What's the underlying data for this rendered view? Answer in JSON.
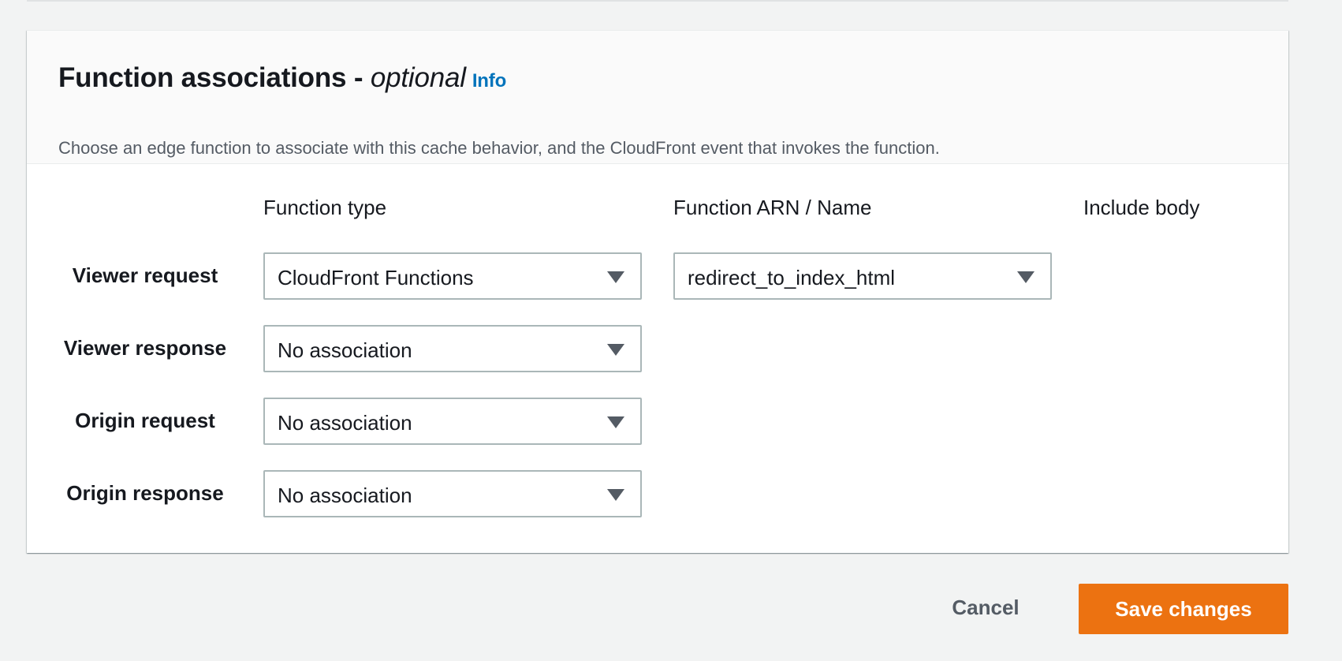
{
  "panel": {
    "title": "Function associations",
    "title_dash": " - ",
    "title_optional": "optional",
    "info_link": "Info",
    "description": "Choose an edge function to associate with this cache behavior, and the CloudFront event that invokes the function."
  },
  "columns": {
    "function_type": "Function type",
    "function_arn": "Function ARN / Name",
    "include_body": "Include body"
  },
  "rows": [
    {
      "label": "Viewer request",
      "function_type": "CloudFront Functions",
      "function_arn": "redirect_to_index_html"
    },
    {
      "label": "Viewer response",
      "function_type": "No association"
    },
    {
      "label": "Origin request",
      "function_type": "No association"
    },
    {
      "label": "Origin response",
      "function_type": "No association"
    }
  ],
  "actions": {
    "cancel": "Cancel",
    "save": "Save changes"
  },
  "colors": {
    "accent": "#ec7211",
    "link": "#0073bb"
  },
  "icons": {
    "select_caret": "caret-down-icon"
  }
}
